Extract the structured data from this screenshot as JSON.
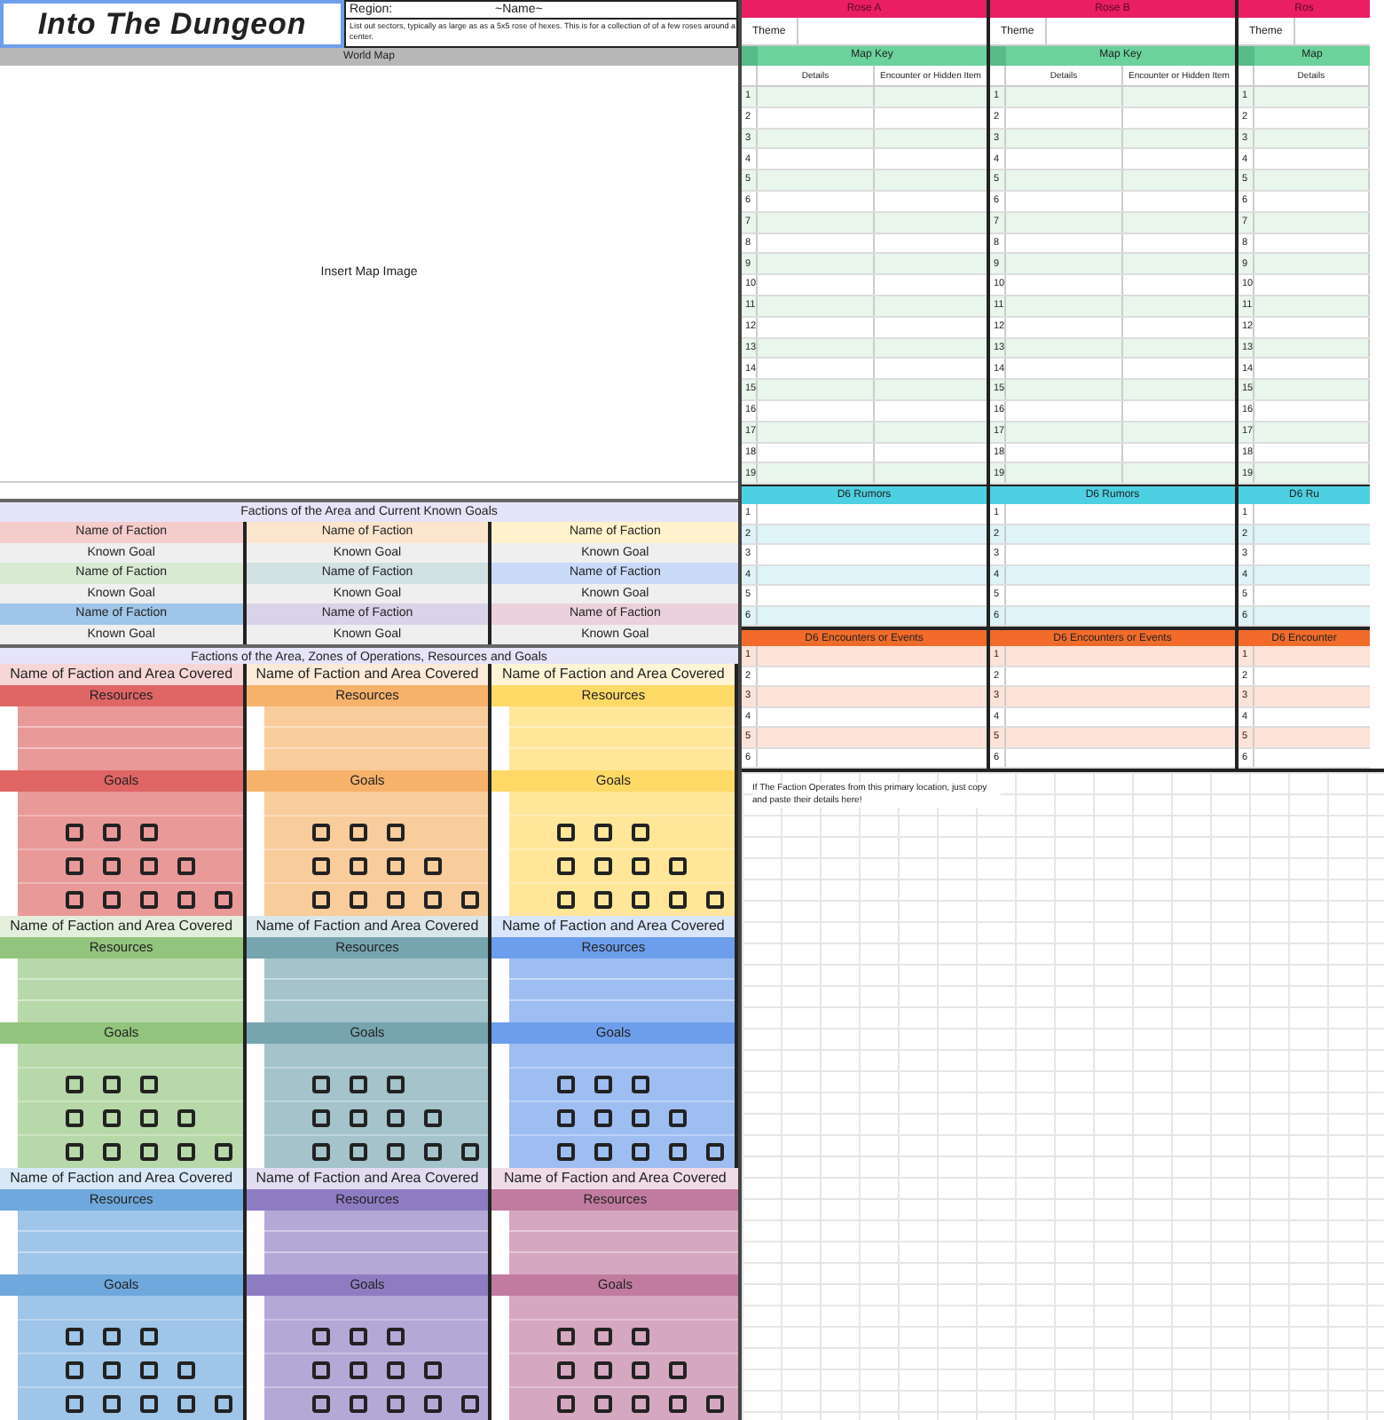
{
  "title": "Into The Dungeon",
  "region": {
    "label": "Region:",
    "value": "~Name~",
    "note": "List out sectors, typically as large as as a 5x5 rose of hexes. This is for a collection of of a few roses around a center."
  },
  "world_map": {
    "title": "World Map",
    "placeholder": "Insert Map Image"
  },
  "known_goals": {
    "title": "Factions of the Area and Current Known Goals",
    "factions": [
      {
        "name": "Name of Faction",
        "goal": "Known Goal",
        "color": "#f4cccc"
      },
      {
        "name": "Name of Faction",
        "goal": "Known Goal",
        "color": "#fce5cd"
      },
      {
        "name": "Name of Faction",
        "goal": "Known Goal",
        "color": "#fff2cc"
      },
      {
        "name": "Name of Faction",
        "goal": "Known Goal",
        "color": "#d9ead3"
      },
      {
        "name": "Name of Faction",
        "goal": "Known Goal",
        "color": "#d0e0e3"
      },
      {
        "name": "Name of Faction",
        "goal": "Known Goal",
        "color": "#c9daf8"
      },
      {
        "name": "Name of Faction",
        "goal": "Known Goal",
        "color": "#9fc5e8"
      },
      {
        "name": "Name of Faction",
        "goal": "Known Goal",
        "color": "#d9d2e9"
      },
      {
        "name": "Name of Faction",
        "goal": "Known Goal",
        "color": "#ead1dc"
      }
    ]
  },
  "faction_cards": {
    "title": "Factions of the Area, Zones of Operations, Resources and Goals",
    "cards": [
      {
        "name": "Name of Faction and Area Covered",
        "resources": "Resources",
        "goals": "Goals",
        "color": "#e06666",
        "tracks": [
          {
            "boxes": [
              {
                "checked": false
              },
              {
                "checked": false
              },
              {
                "checked": false
              }
            ]
          },
          {
            "boxes": [
              {
                "checked": false
              },
              {
                "checked": false
              },
              {
                "checked": false
              },
              {
                "checked": false
              }
            ]
          },
          {
            "boxes": [
              {
                "checked": false
              },
              {
                "checked": false
              },
              {
                "checked": false
              },
              {
                "checked": false
              },
              {
                "checked": false
              }
            ]
          }
        ]
      },
      {
        "name": "Name of Faction and Area Covered",
        "resources": "Resources",
        "goals": "Goals",
        "color": "#f6b26b",
        "tracks": [
          {
            "boxes": [
              {
                "checked": false
              },
              {
                "checked": false
              },
              {
                "checked": false
              }
            ]
          },
          {
            "boxes": [
              {
                "checked": false
              },
              {
                "checked": false
              },
              {
                "checked": false
              },
              {
                "checked": false
              }
            ]
          },
          {
            "boxes": [
              {
                "checked": false
              },
              {
                "checked": false
              },
              {
                "checked": false
              },
              {
                "checked": false
              },
              {
                "checked": false
              }
            ]
          }
        ]
      },
      {
        "name": "Name of Faction and Area Covered",
        "resources": "Resources",
        "goals": "Goals",
        "color": "#ffd966",
        "tracks": [
          {
            "boxes": [
              {
                "checked": false
              },
              {
                "checked": false
              },
              {
                "checked": false
              }
            ]
          },
          {
            "boxes": [
              {
                "checked": false
              },
              {
                "checked": false
              },
              {
                "checked": false
              },
              {
                "checked": false
              }
            ]
          },
          {
            "boxes": [
              {
                "checked": false
              },
              {
                "checked": false
              },
              {
                "checked": false
              },
              {
                "checked": false
              },
              {
                "checked": false
              }
            ]
          }
        ]
      },
      {
        "name": "Name of Faction and Area Covered",
        "resources": "Resources",
        "goals": "Goals",
        "color": "#93c47d",
        "tracks": [
          {
            "boxes": [
              {
                "checked": false
              },
              {
                "checked": false
              },
              {
                "checked": false
              }
            ]
          },
          {
            "boxes": [
              {
                "checked": false
              },
              {
                "checked": false
              },
              {
                "checked": false
              },
              {
                "checked": false
              }
            ]
          },
          {
            "boxes": [
              {
                "checked": false
              },
              {
                "checked": false
              },
              {
                "checked": false
              },
              {
                "checked": false
              },
              {
                "checked": false
              }
            ]
          }
        ]
      },
      {
        "name": "Name of Faction and Area Covered",
        "resources": "Resources",
        "goals": "Goals",
        "color": "#76a5af",
        "tracks": [
          {
            "boxes": [
              {
                "checked": false
              },
              {
                "checked": false
              },
              {
                "checked": false
              }
            ]
          },
          {
            "boxes": [
              {
                "checked": false
              },
              {
                "checked": false
              },
              {
                "checked": false
              },
              {
                "checked": false
              }
            ]
          },
          {
            "boxes": [
              {
                "checked": false
              },
              {
                "checked": false
              },
              {
                "checked": false
              },
              {
                "checked": false
              },
              {
                "checked": false
              }
            ]
          }
        ]
      },
      {
        "name": "Name of Faction and Area Covered",
        "resources": "Resources",
        "goals": "Goals",
        "color": "#6d9eeb",
        "tracks": [
          {
            "boxes": [
              {
                "checked": false
              },
              {
                "checked": false
              },
              {
                "checked": false
              }
            ]
          },
          {
            "boxes": [
              {
                "checked": false
              },
              {
                "checked": false
              },
              {
                "checked": false
              },
              {
                "checked": false
              }
            ]
          },
          {
            "boxes": [
              {
                "checked": false
              },
              {
                "checked": false
              },
              {
                "checked": false
              },
              {
                "checked": false
              },
              {
                "checked": false
              }
            ]
          }
        ]
      },
      {
        "name": "Name of Faction and Area Covered",
        "resources": "Resources",
        "goals": "Goals",
        "color": "#6fa8dc",
        "tracks": [
          {
            "boxes": [
              {
                "checked": false
              },
              {
                "checked": false
              },
              {
                "checked": false
              }
            ]
          },
          {
            "boxes": [
              {
                "checked": false
              },
              {
                "checked": false
              },
              {
                "checked": false
              },
              {
                "checked": false
              }
            ]
          },
          {
            "boxes": [
              {
                "checked": false
              },
              {
                "checked": false
              },
              {
                "checked": false
              },
              {
                "checked": false
              },
              {
                "checked": false
              }
            ]
          }
        ]
      },
      {
        "name": "Name of Faction and Area Covered",
        "resources": "Resources",
        "goals": "Goals",
        "color": "#8e7cc3",
        "tracks": [
          {
            "boxes": [
              {
                "checked": false
              },
              {
                "checked": false
              },
              {
                "checked": false
              }
            ]
          },
          {
            "boxes": [
              {
                "checked": false
              },
              {
                "checked": false
              },
              {
                "checked": false
              },
              {
                "checked": false
              }
            ]
          },
          {
            "boxes": [
              {
                "checked": false
              },
              {
                "checked": false
              },
              {
                "checked": false
              },
              {
                "checked": false
              },
              {
                "checked": false
              }
            ]
          }
        ]
      },
      {
        "name": "Name of Faction and Area Covered",
        "resources": "Resources",
        "goals": "Goals",
        "color": "#c27ba0",
        "tracks": [
          {
            "boxes": [
              {
                "checked": false
              },
              {
                "checked": false
              },
              {
                "checked": false
              }
            ]
          },
          {
            "boxes": [
              {
                "checked": false
              },
              {
                "checked": false
              },
              {
                "checked": false
              },
              {
                "checked": false
              }
            ]
          },
          {
            "boxes": [
              {
                "checked": false
              },
              {
                "checked": false
              },
              {
                "checked": false
              },
              {
                "checked": false
              },
              {
                "checked": false
              }
            ]
          }
        ]
      }
    ]
  },
  "roses": [
    {
      "title": "Rose A",
      "theme": "Theme",
      "map_key": "Map Key",
      "columns": [
        "Details",
        "Encounter or Hidden Item"
      ],
      "rows": [
        "1",
        "2",
        "3",
        "4",
        "5",
        "6",
        "7",
        "8",
        "9",
        "10",
        "11",
        "12",
        "13",
        "14",
        "15",
        "16",
        "17",
        "18",
        "19"
      ],
      "rumors": "D6 Rumors",
      "rumor_rows": [
        "1",
        "2",
        "3",
        "4",
        "5",
        "6"
      ],
      "encounters": "D6 Encounters or Events",
      "encounter_rows": [
        "1",
        "2",
        "3",
        "4",
        "5",
        "6"
      ]
    },
    {
      "title": "Rose B",
      "theme": "Theme",
      "map_key": "Map Key",
      "columns": [
        "Details",
        "Encounter or Hidden Item"
      ],
      "rows": [
        "1",
        "2",
        "3",
        "4",
        "5",
        "6",
        "7",
        "8",
        "9",
        "10",
        "11",
        "12",
        "13",
        "14",
        "15",
        "16",
        "17",
        "18",
        "19"
      ],
      "rumors": "D6 Rumors",
      "rumor_rows": [
        "1",
        "2",
        "3",
        "4",
        "5",
        "6"
      ],
      "encounters": "D6 Encounters or Events",
      "encounter_rows": [
        "1",
        "2",
        "3",
        "4",
        "5",
        "6"
      ]
    },
    {
      "title": "Ros",
      "theme": "Theme",
      "map_key": "Map",
      "columns": [
        "Details"
      ],
      "rows": [
        "1",
        "2",
        "3",
        "4",
        "5",
        "6",
        "7",
        "8",
        "9",
        "10",
        "11",
        "12",
        "13",
        "14",
        "15",
        "16",
        "17",
        "18",
        "19"
      ],
      "rumors": "D6 Ru",
      "rumor_rows": [
        "1",
        "2",
        "3",
        "4",
        "5",
        "6"
      ],
      "encounters": "D6 Encounter",
      "encounter_rows": [
        "1",
        "2",
        "3",
        "4",
        "5",
        "6"
      ]
    }
  ],
  "note": "If The Faction Operates from this primary location, just copy and paste their details here!"
}
